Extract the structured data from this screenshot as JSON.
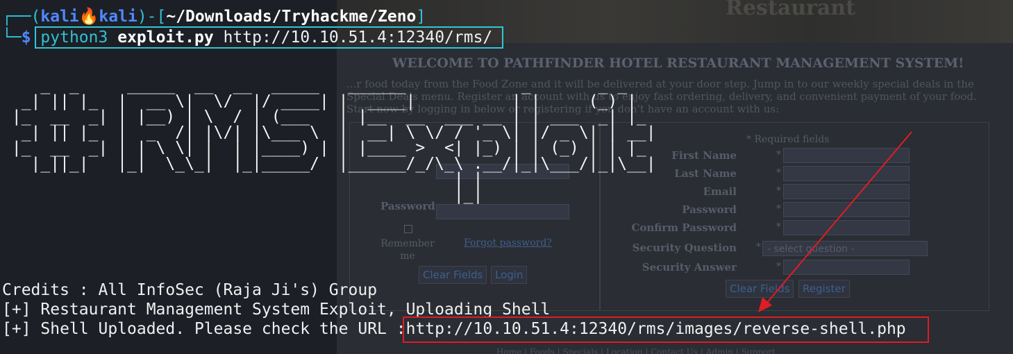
{
  "terminal": {
    "prompt": {
      "corner_top": "┌──(",
      "user_host": "kali🔥kali",
      "mid": ")-[",
      "path": "~/Downloads/Tryhackme/Zeno",
      "end": "]",
      "corner_bottom": "└─",
      "dollar": "$"
    },
    "command": {
      "interpreter": "python3",
      "script": "exploit.py",
      "url": "http://10.10.51.4:12340/rms/"
    },
    "banner_ascii": "    _  _     _____  __  __  _____   ______            _       _ _\n  _| || |_  |  __ \\|  \\/  |/ ____| |  ____|          | |     (_) |\n |_  __  _| | |__) | \\  / | (___   | |__  __  ___ __ | | ___  _| |_\n  _| || |_  |  _  /| |\\/| |\\___ \\  |  __| \\ \\/ / '_ \\| |/ _ \\| | __|\n |_  __  _| | | \\ \\| |  | |____) | | |____ >  <| |_) | | (_) | | |_\n   |_||_|   |_|  \\_\\_|  |_|_____/  |______/_/\\_\\ .__/|_|\\___/|_|\\__|\n                                               | |\n                                               |_|",
    "output": {
      "credits": "Credits : All InfoSec (Raja Ji's) Group",
      "uploading": "[+] Restaurant Management System Exploit, Uploading Shell",
      "uploaded_prefix": "[+] Shell Uploaded. Please check the URL :",
      "uploaded_url": "http://10.10.51.4:12340/rms/images/reverse-shell.php"
    }
  },
  "background_page": {
    "banner_title": "Restaurant",
    "welcome": "WELCOME TO PATHFINDER HOTEL RESTAURANT MANAGEMENT SYSTEM!",
    "intro": "...r food today from the Food Zone and it will be delivered at your door step. Jump in to our weekly special deals in the Special Deals menu. Register an account with us to enjoy fast ordering, delivery, and convenient payment of your food. Start now by logging in below or registering if you don't have an account with us:",
    "login": {
      "required_note": "* Required fields",
      "password_label": "Password",
      "remember_label": "Remember me",
      "forgot_link": "Forgot password?",
      "clear_button": "Clear Fields",
      "login_button": "Login"
    },
    "register": {
      "required_note": "* Required fields",
      "fields": [
        "First Name",
        "Last Name",
        "Email",
        "Password",
        "Confirm Password",
        "Security Question",
        "Security Answer"
      ],
      "select_placeholder": "- select question -",
      "clear_button": "Clear Fields",
      "register_button": "Register"
    },
    "bottom_nav": "Home | Foods | Specials | Location | Contact Us | Admin | Support"
  },
  "annotations": {
    "command_highlight_color": "#32c6d3",
    "url_highlight_color": "#e01c24",
    "arrow_color": "#e01c24"
  }
}
